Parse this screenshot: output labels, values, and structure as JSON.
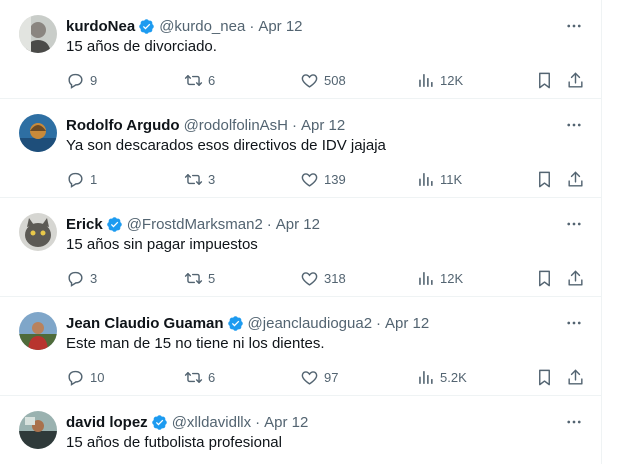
{
  "colors": {
    "verified": "#1d9bf0",
    "muted": "#536471",
    "text": "#0f1419",
    "divider": "#eff3f4"
  },
  "icons": {
    "reply": "reply-icon",
    "retweet": "retweet-icon",
    "like": "like-icon",
    "views": "views-icon",
    "bookmark": "bookmark-icon",
    "share": "share-icon",
    "more": "more-icon",
    "verified": "verified-icon"
  },
  "tweets": [
    {
      "name": "kurdoNea",
      "verified": true,
      "handle": "@kurdo_nea",
      "date": "Apr 12",
      "text": "15 años de divorciado.",
      "replies": "9",
      "retweets": "6",
      "likes": "508",
      "views": "12K"
    },
    {
      "name": "Rodolfo Argudo",
      "verified": false,
      "handle": "@rodolfolinAsH",
      "date": "Apr 12",
      "text": "Ya son descarados esos directivos de IDV jajaja",
      "replies": "1",
      "retweets": "3",
      "likes": "139",
      "views": "11K"
    },
    {
      "name": "Erick",
      "verified": true,
      "handle": "@FrostdMarksman2",
      "date": "Apr 12",
      "text": "15 años sin pagar impuestos",
      "replies": "3",
      "retweets": "5",
      "likes": "318",
      "views": "12K"
    },
    {
      "name": "Jean Claudio Guaman",
      "verified": true,
      "handle": "@jeanclaudiogua2",
      "date": "Apr 12",
      "text": "Este man de 15 no tiene ni los dientes.",
      "replies": "10",
      "retweets": "6",
      "likes": "97",
      "views": "5.2K"
    },
    {
      "name": "david lopez",
      "verified": true,
      "handle": "@xlldavidllx",
      "date": "Apr 12",
      "text": "15 años de futbolista profesional",
      "replies": "",
      "retweets": "",
      "likes": "",
      "views": ""
    }
  ]
}
